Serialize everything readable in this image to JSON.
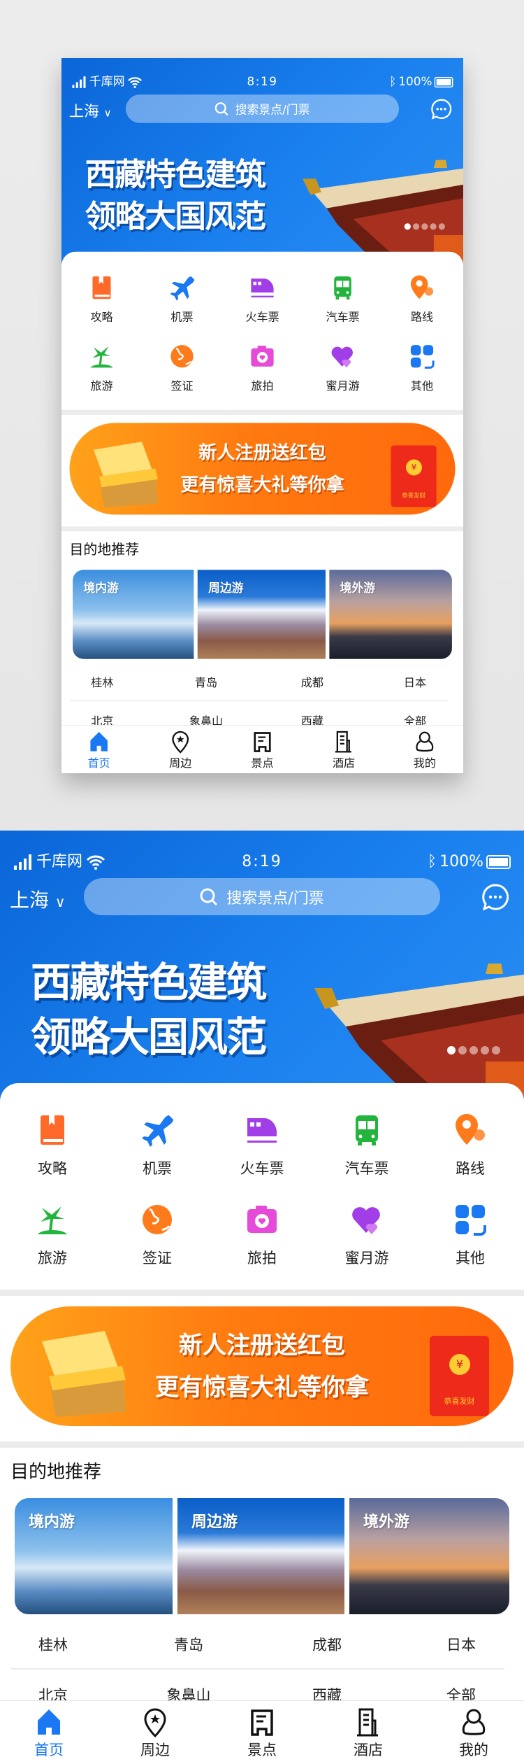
{
  "status": {
    "carrier": "千库网",
    "time": "8:19",
    "battery": "100%"
  },
  "header": {
    "city": "上海",
    "search_placeholder": "搜索景点/门票",
    "headline1": "西藏特色建筑",
    "headline2": "领略大国风范",
    "slides": 5,
    "active_slide": 1
  },
  "grid": [
    {
      "label": "攻略",
      "icon": "guide-book-icon",
      "color": "#ff6a2a"
    },
    {
      "label": "机票",
      "icon": "airplane-icon",
      "color": "#1a78f2"
    },
    {
      "label": "火车票",
      "icon": "train-icon",
      "color": "#a23ee8"
    },
    {
      "label": "汽车票",
      "icon": "bus-icon",
      "color": "#22b43c"
    },
    {
      "label": "路线",
      "icon": "route-pin-icon",
      "color": "#ff7a1a"
    },
    {
      "label": "旅游",
      "icon": "palm-tree-icon",
      "color": "#22b43c"
    },
    {
      "label": "签证",
      "icon": "globe-icon",
      "color": "#ff7a1a"
    },
    {
      "label": "旅拍",
      "icon": "camera-icon",
      "color": "#e64ad8"
    },
    {
      "label": "蜜月游",
      "icon": "hearts-icon",
      "color": "#a23ee8"
    },
    {
      "label": "其他",
      "icon": "grid-more-icon",
      "color": "#1a78f2"
    }
  ],
  "promo": {
    "line1": "新人注册送红包",
    "line2": "更有惊喜大礼等你拿",
    "envelope_text": "恭喜发财"
  },
  "destinations": {
    "title": "目的地推荐",
    "cards": [
      "境内游",
      "周边游",
      "境外游"
    ],
    "row1": [
      "桂林",
      "青岛",
      "成都",
      "日本"
    ],
    "row2": [
      "北京",
      "象鼻山",
      "西藏",
      "全部"
    ]
  },
  "tabs": [
    {
      "label": "首页",
      "icon": "home-icon",
      "active": true
    },
    {
      "label": "周边",
      "icon": "nearby-pin-icon"
    },
    {
      "label": "景点",
      "icon": "scenic-ticket-icon"
    },
    {
      "label": "酒店",
      "icon": "hotel-building-icon"
    },
    {
      "label": "我的",
      "icon": "user-icon"
    }
  ],
  "accent": "#1a78f2"
}
